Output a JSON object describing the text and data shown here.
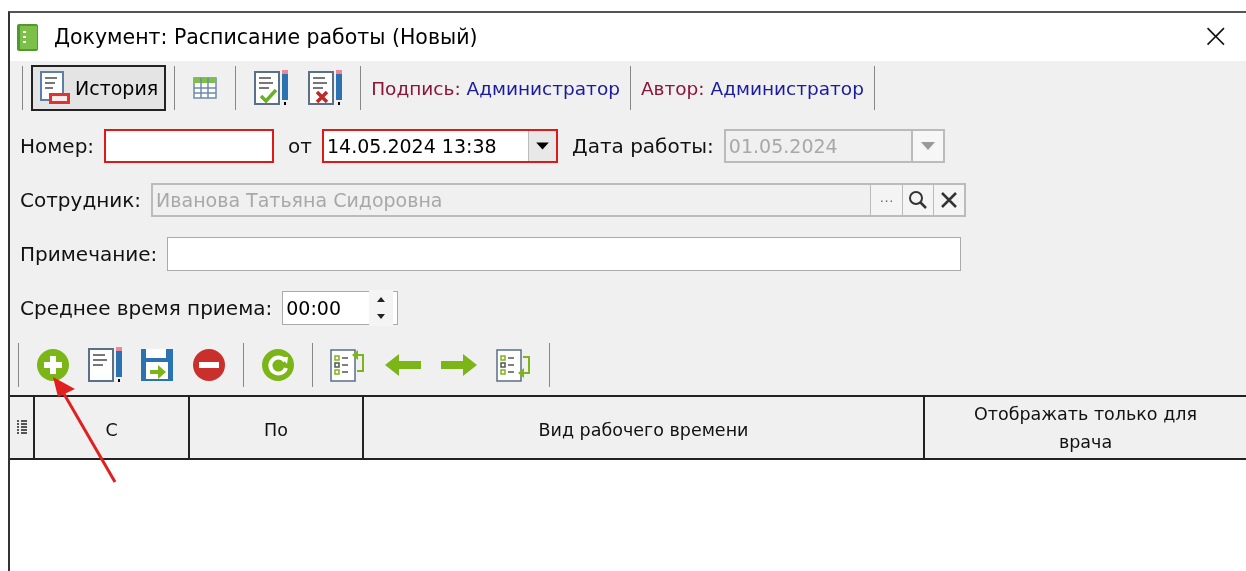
{
  "window": {
    "title": "Документ:  Расписание работы  (Новый)",
    "close": "×"
  },
  "toolbar": {
    "history_button": "История",
    "signature": {
      "label": "Подпись:",
      "value": "Администратор"
    },
    "author": {
      "label": "Автор:",
      "value": "Администратор"
    }
  },
  "fields": [
    {
      "kind": "text",
      "label": "Номер:",
      "invalid": true,
      "disabled": false
    },
    {
      "kind": "date",
      "label": "от",
      "value": "14.05.2024 13:38",
      "invalid": true,
      "disabled": false
    },
    {
      "kind": "date",
      "label": "Дата работы:",
      "value": "01.05.2024",
      "invalid": false,
      "disabled": true
    },
    {
      "kind": "lookup",
      "label": "Сотрудник:",
      "value": "Иванова Татьяна Сидоровна",
      "invalid": false,
      "disabled": true,
      "ellipsis": "···"
    },
    {
      "kind": "text",
      "label": "Примечание:",
      "invalid": false,
      "disabled": false
    },
    {
      "kind": "spin",
      "label": "Среднее время приема:",
      "value": "00:00",
      "invalid": false,
      "disabled": false
    }
  ],
  "table": {
    "columns": [
      "С",
      "По",
      "Вид рабочего времени",
      "Отображать только для врача"
    ]
  }
}
